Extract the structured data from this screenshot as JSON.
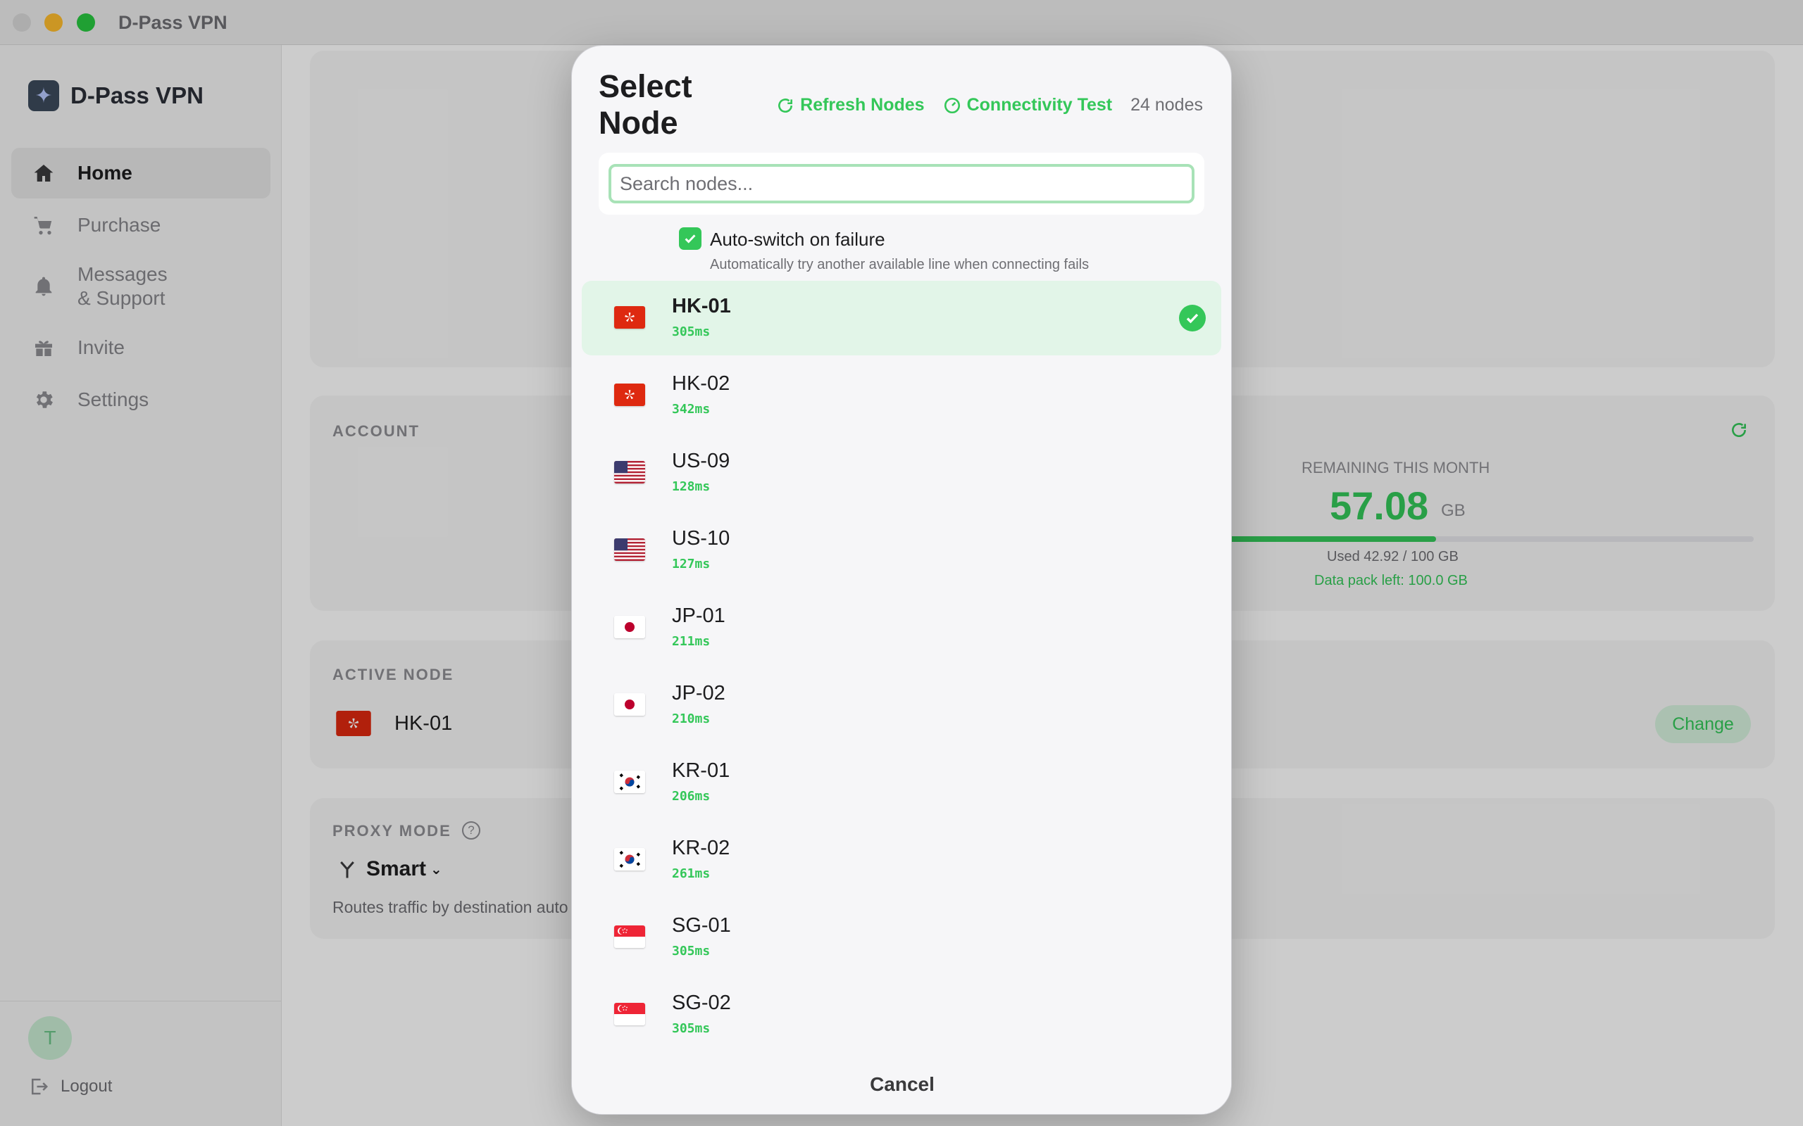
{
  "window": {
    "title": "D-Pass VPN"
  },
  "sidebar": {
    "brand": "D-Pass VPN",
    "items": [
      {
        "label": "Home",
        "icon": "home-icon",
        "active": true
      },
      {
        "label": "Purchase",
        "icon": "cart-icon",
        "active": false
      },
      {
        "label": "Messages\n& Support",
        "icon": "bell-icon",
        "active": false
      },
      {
        "label": "Invite",
        "icon": "gift-icon",
        "active": false
      },
      {
        "label": "Settings",
        "icon": "gear-icon",
        "active": false
      }
    ],
    "avatar_initial": "T",
    "logout": "Logout"
  },
  "main": {
    "account": {
      "label": "ACCOUNT",
      "remaining_label": "REMAINING THIS MONTH",
      "remaining_value": "57.08",
      "remaining_unit": "GB",
      "used_fraction": 0.4292,
      "used_text": "Used 42.92 / 100 GB",
      "data_pack_text": "Data pack left: 100.0 GB"
    },
    "active_node": {
      "label": "ACTIVE NODE",
      "name": "HK-01",
      "change": "Change"
    },
    "proxy_mode": {
      "label": "PROXY MODE",
      "help": "?",
      "mode": "Smart",
      "description": "Routes traffic by destination auto"
    }
  },
  "modal": {
    "title": "Select Node",
    "refresh": "Refresh Nodes",
    "connectivity": "Connectivity Test",
    "count": "24 nodes",
    "search_placeholder": "Search nodes...",
    "auto_switch_label": "Auto-switch on failure",
    "auto_switch_desc": "Automatically try another available line when connecting fails",
    "auto_switch_checked": true,
    "nodes": [
      {
        "name": "HK-01",
        "latency": "305ms",
        "flag": "hk",
        "selected": true
      },
      {
        "name": "HK-02",
        "latency": "342ms",
        "flag": "hk",
        "selected": false
      },
      {
        "name": "US-09",
        "latency": "128ms",
        "flag": "us",
        "selected": false
      },
      {
        "name": "US-10",
        "latency": "127ms",
        "flag": "us",
        "selected": false
      },
      {
        "name": "JP-01",
        "latency": "211ms",
        "flag": "jp",
        "selected": false
      },
      {
        "name": "JP-02",
        "latency": "210ms",
        "flag": "jp",
        "selected": false
      },
      {
        "name": "KR-01",
        "latency": "206ms",
        "flag": "kr",
        "selected": false
      },
      {
        "name": "KR-02",
        "latency": "261ms",
        "flag": "kr",
        "selected": false
      },
      {
        "name": "SG-01",
        "latency": "305ms",
        "flag": "sg",
        "selected": false
      },
      {
        "name": "SG-02",
        "latency": "305ms",
        "flag": "sg",
        "selected": false
      }
    ],
    "cancel": "Cancel"
  },
  "colors": {
    "accent": "#34c759",
    "selected_row": "#e2f5e8"
  }
}
